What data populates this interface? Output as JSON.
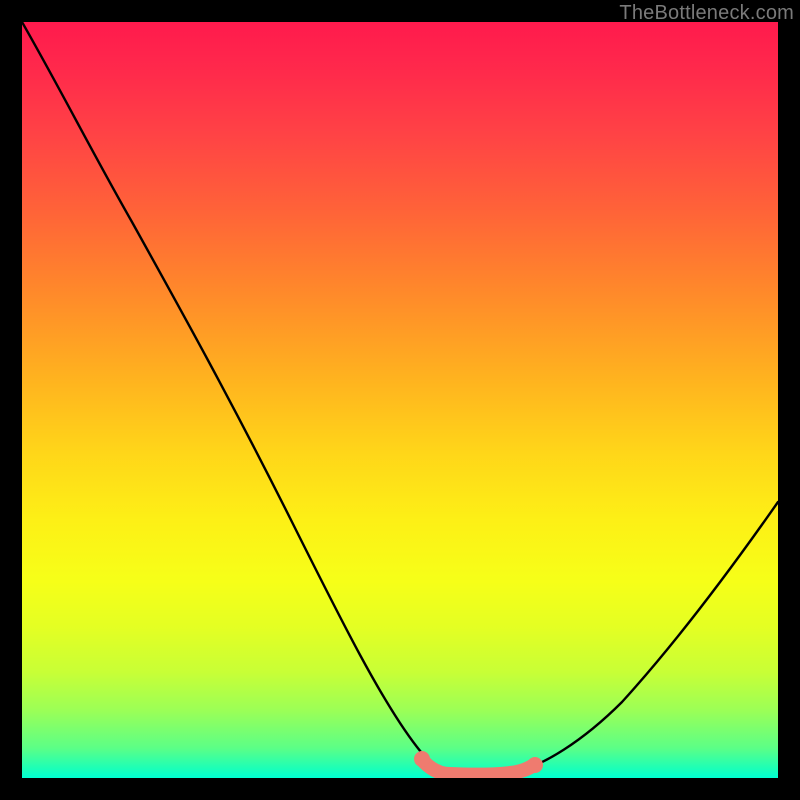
{
  "watermark": {
    "text": "TheBottleneck.com"
  },
  "colors": {
    "background": "#000000",
    "curve": "#000000",
    "highlight": "#ef7b6f",
    "gradient_top": "#ff1a4d",
    "gradient_bottom": "#00ffd2"
  },
  "chart_data": {
    "type": "line",
    "title": "",
    "xlabel": "",
    "ylabel": "",
    "xlim": [
      0,
      100
    ],
    "ylim": [
      0,
      100
    ],
    "grid": false,
    "background": "rainbow-gradient (top=red/bad → bottom=green/good)",
    "curve_description": "Bottleneck percentage vs. hardware balance. Steep descent from top-left to a flat near-zero minimum around x≈55–65, then rise toward the right.",
    "x": [
      0,
      5,
      10,
      15,
      20,
      25,
      30,
      35,
      40,
      45,
      50,
      53,
      55,
      58,
      60,
      63,
      65,
      70,
      75,
      80,
      85,
      90,
      95,
      100
    ],
    "y": [
      100,
      90,
      80,
      70,
      60,
      50,
      40,
      30,
      21,
      13,
      6,
      2,
      1,
      0,
      0,
      0,
      1,
      4,
      9,
      15,
      22,
      30,
      38,
      47
    ],
    "highlight_segment": {
      "description": "Thick salmon band marking the optimal/minimum region",
      "x_range": [
        53,
        65
      ],
      "y_approx": 0.6,
      "color": "#ef7b6f"
    }
  }
}
